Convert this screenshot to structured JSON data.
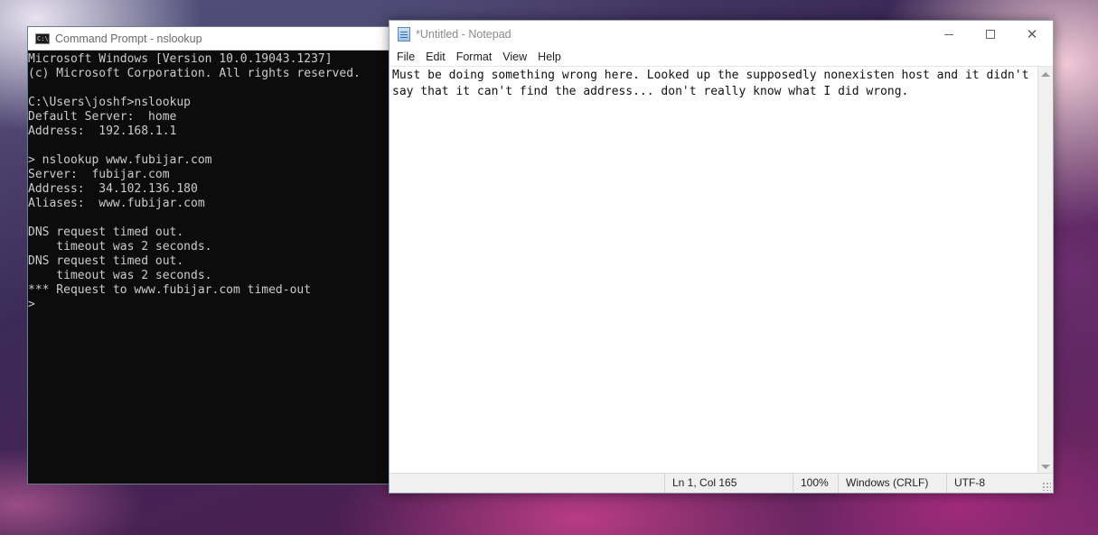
{
  "cmd": {
    "title": "Command Prompt - nslookup",
    "icon_label": "C:\\",
    "lines": [
      "Microsoft Windows [Version 10.0.19043.1237]",
      "(c) Microsoft Corporation. All rights reserved.",
      "",
      "C:\\Users\\joshf>nslookup",
      "Default Server:  home",
      "Address:  192.168.1.1",
      "",
      "> nslookup www.fubijar.com",
      "Server:  fubijar.com",
      "Address:  34.102.136.180",
      "Aliases:  www.fubijar.com",
      "",
      "DNS request timed out.",
      "    timeout was 2 seconds.",
      "DNS request timed out.",
      "    timeout was 2 seconds.",
      "*** Request to www.fubijar.com timed-out",
      ">"
    ]
  },
  "notepad": {
    "title": "*Untitled - Notepad",
    "menu": {
      "file": "File",
      "edit": "Edit",
      "format": "Format",
      "view": "View",
      "help": "Help"
    },
    "content": "Must be doing something wrong here. Looked up the supposedly nonexisten host and it didn't say that it can't find the address... don't really know what I did wrong.",
    "status": {
      "position": "Ln 1, Col 165",
      "zoom": "100%",
      "line_ending": "Windows (CRLF)",
      "encoding": "UTF-8"
    },
    "window_controls": {
      "close": "✕"
    }
  }
}
